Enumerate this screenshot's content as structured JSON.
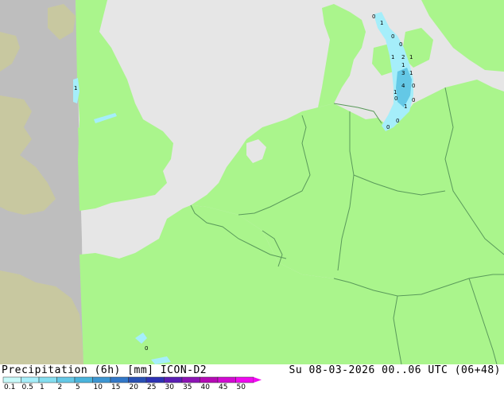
{
  "header": {
    "title_left": "Precipitation (6h) [mm] ICON-D2",
    "title_right": "Su 08-03-2026 00..06 UTC (06+48)"
  },
  "colors": {
    "sea": "#e6e6e6",
    "land": "#aaf58c",
    "out_of_domain": "#bebebe",
    "out_of_domain_land": "#c8c8a0",
    "border": "#5a9a5a"
  },
  "legend": {
    "ticks": [
      "0.1",
      "0.5",
      "1",
      "2",
      "5",
      "10",
      "15",
      "20",
      "25",
      "30",
      "35",
      "40",
      "45",
      "50"
    ],
    "colors": [
      "#c8fafa",
      "#a5eefa",
      "#84def0",
      "#64c8e6",
      "#4ab4dc",
      "#3c96d2",
      "#3278c8",
      "#2850b4",
      "#2d32b4",
      "#5a1eb4",
      "#8c14b4",
      "#b40ab4",
      "#d20ad2",
      "#f00af0"
    ]
  },
  "map": {
    "precip_labels": [
      {
        "text": "0"
      },
      {
        "text": "1"
      },
      {
        "text": "0"
      },
      {
        "text": "0"
      },
      {
        "text": "1"
      },
      {
        "text": "1"
      },
      {
        "text": "2"
      },
      {
        "text": "1"
      },
      {
        "text": "3"
      },
      {
        "text": "1"
      },
      {
        "text": "4"
      },
      {
        "text": "0"
      },
      {
        "text": "1"
      },
      {
        "text": "0"
      },
      {
        "text": "0"
      },
      {
        "text": "1"
      },
      {
        "text": "0"
      },
      {
        "text": "0"
      },
      {
        "text": "1"
      },
      {
        "text": "0"
      }
    ]
  }
}
